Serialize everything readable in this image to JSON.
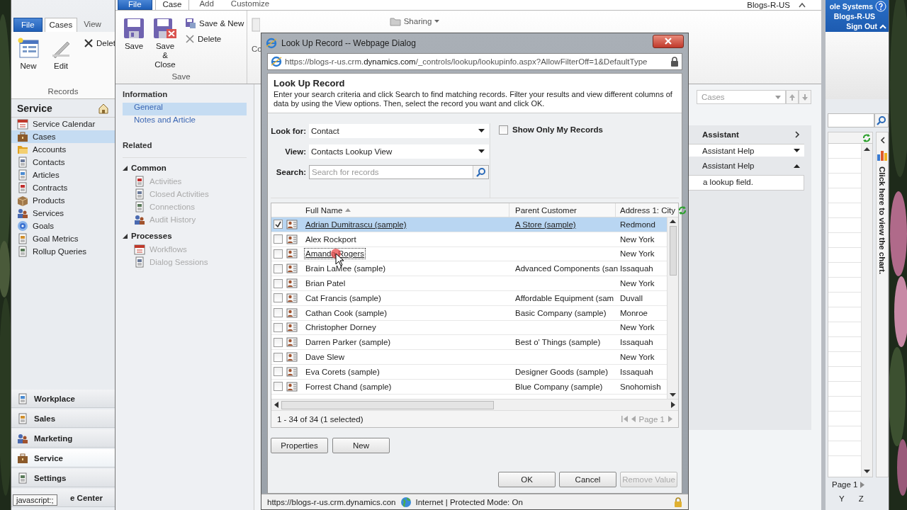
{
  "main_window": {
    "ribbon_tabs": [
      {
        "label": "File",
        "kind": "file",
        "selected": false
      },
      {
        "label": "Cases",
        "kind": "tab",
        "selected": true
      },
      {
        "label": "View",
        "kind": "tab",
        "selected": false
      }
    ],
    "ribbon_buttons": [
      {
        "label": "New",
        "kind": "large"
      },
      {
        "label": "Edit",
        "kind": "large"
      },
      {
        "label": "Delet",
        "kind": "small"
      }
    ],
    "group_label": "Records",
    "nav_title": "Service",
    "nav_items": [
      {
        "label": "Service Calendar",
        "selected": false
      },
      {
        "label": "Cases",
        "selected": true
      },
      {
        "label": "Accounts",
        "selected": false
      },
      {
        "label": "Contacts",
        "selected": false
      },
      {
        "label": "Articles",
        "selected": false
      },
      {
        "label": "Contracts",
        "selected": false
      },
      {
        "label": "Products",
        "selected": false
      },
      {
        "label": "Services",
        "selected": false
      },
      {
        "label": "Goals",
        "selected": false
      },
      {
        "label": "Goal Metrics",
        "selected": false
      },
      {
        "label": "Rollup Queries",
        "selected": false
      }
    ],
    "workspaces": [
      {
        "label": "Workplace",
        "kind": "full",
        "selected": false
      },
      {
        "label": "Sales",
        "kind": "full",
        "selected": false
      },
      {
        "label": "Marketing",
        "kind": "full",
        "selected": false
      },
      {
        "label": "Service",
        "kind": "full",
        "selected": true
      },
      {
        "label": "Settings",
        "kind": "full",
        "selected": false
      },
      {
        "label": "e Center",
        "kind": "covered",
        "selected": false
      }
    ],
    "tooltip": "javascript:;",
    "header": {
      "organization": "ole Systems",
      "user": "Blogs-R-US",
      "sign_out": "Sign Out"
    },
    "chart_pane": {
      "label": "Click here to view the chart."
    },
    "pager": "Page 1",
    "index_letters": [
      "Y",
      "Z"
    ]
  },
  "case_window": {
    "top_bar": {
      "user": "Blogs-R-US"
    },
    "ribbon_tabs": [
      {
        "label": "File",
        "kind": "file",
        "selected": false
      },
      {
        "label": "Case",
        "kind": "tab",
        "selected": true
      },
      {
        "label": "Add",
        "kind": "tab",
        "selected": false
      },
      {
        "label": "Customize",
        "kind": "tab",
        "selected": false
      }
    ],
    "ribbon_buttons": [
      {
        "label": "Save",
        "kind": "large"
      },
      {
        "label": "Save & Close",
        "kind": "large"
      },
      {
        "label": "Save & New",
        "kind": "small"
      },
      {
        "label": "Delete",
        "kind": "small"
      }
    ],
    "group_label": "Save",
    "covered_button": "Co",
    "sharing_button": "Sharing",
    "information": {
      "title": "Information",
      "items": [
        {
          "label": "General",
          "selected": true,
          "disabled": false
        },
        {
          "label": "Notes and Article",
          "selected": false,
          "disabled": false
        }
      ]
    },
    "related": {
      "title": "Related",
      "groups": [
        {
          "title": "Common",
          "expanded": true,
          "items": [
            {
              "label": "Activities",
              "selected": false,
              "disabled": true
            },
            {
              "label": "Closed Activities",
              "selected": false,
              "disabled": true
            },
            {
              "label": "Connections",
              "selected": false,
              "disabled": true
            },
            {
              "label": "Audit History",
              "selected": false,
              "disabled": true
            }
          ]
        },
        {
          "title": "Processes",
          "expanded": true,
          "items": [
            {
              "label": "Workflows",
              "selected": false,
              "disabled": true
            },
            {
              "label": "Dialog Sessions",
              "selected": false,
              "disabled": true
            }
          ]
        }
      ]
    },
    "right_panel": {
      "view_select": "Cases",
      "assistant_title": "Assistant",
      "help_select": "Assistant Help",
      "help_title": "Assistant Help",
      "help_text": "a lookup field."
    }
  },
  "dialog": {
    "title": "Look Up Record -- Webpage Dialog",
    "address": "https://blogs-r-us.crm.**dynamics.com**/_controls/lookup/lookupinfo.aspx?AllowFilterOff=1&DefaultType",
    "heading": "Look Up Record",
    "description": "Enter your search criteria and click Search to find matching records. Filter your results and view different columns of data by using the View options. Then, select the record you want and click OK.",
    "fields": [
      {
        "label": "Look for:",
        "kind": "select",
        "value": "Contact"
      },
      {
        "label": "View:",
        "kind": "select",
        "value": "Contacts Lookup View"
      },
      {
        "label": "Search:",
        "kind": "search",
        "placeholder": "Search for records"
      }
    ],
    "only_my_records": {
      "label": "Show Only My Records",
      "checked": false
    },
    "grid": {
      "columns": [
        {
          "label": "Full Name",
          "sorted": true
        },
        {
          "label": "Parent Customer",
          "sorted": false
        },
        {
          "label": "Address 1: City",
          "sorted": false
        }
      ],
      "rows": [
        {
          "name": "Adrian Dumitrascu (sample)",
          "parent": "A Store (sample)",
          "city": "Redmond",
          "checked": true,
          "selected": true,
          "hovered": false
        },
        {
          "name": "Alex Rockport",
          "city": "New York",
          "checked": false,
          "selected": false,
          "hovered": false
        },
        {
          "name": "Amanda Rogers",
          "city": "New York",
          "checked": false,
          "selected": false,
          "hovered": true
        },
        {
          "name": "Brain LaMee (sample)",
          "parent": "Advanced Components (san",
          "city": "Issaquah",
          "checked": false,
          "selected": false,
          "hovered": false
        },
        {
          "name": "Brian Patel",
          "city": "New York",
          "checked": false,
          "selected": false,
          "hovered": false
        },
        {
          "name": "Cat Francis (sample)",
          "parent": "Affordable Equipment (sam",
          "city": "Duvall",
          "checked": false,
          "selected": false,
          "hovered": false
        },
        {
          "name": "Cathan Cook (sample)",
          "parent": "Basic Company (sample)",
          "city": "Monroe",
          "checked": false,
          "selected": false,
          "hovered": false
        },
        {
          "name": "Christopher Dorney",
          "city": "New York",
          "checked": false,
          "selected": false,
          "hovered": false
        },
        {
          "name": "Darren Parker (sample)",
          "parent": "Best o' Things (sample)",
          "city": "Issaquah",
          "checked": false,
          "selected": false,
          "hovered": false
        },
        {
          "name": "Dave Slew",
          "city": "New York",
          "checked": false,
          "selected": false,
          "hovered": false
        },
        {
          "name": "Eva Corets (sample)",
          "parent": "Designer Goods (sample)",
          "city": "Issaquah",
          "checked": false,
          "selected": false,
          "hovered": false
        },
        {
          "name": "Forrest Chand (sample)",
          "parent": "Blue Company (sample)",
          "city": "Snohomish",
          "checked": false,
          "selected": false,
          "hovered": false
        }
      ],
      "record_count": "1 - 34 of 34 (1 selected)",
      "page": "Page 1"
    },
    "buttons": [
      {
        "label": "Properties"
      },
      {
        "label": "New"
      }
    ],
    "actions": [
      {
        "label": "OK",
        "disabled": false
      },
      {
        "label": "Cancel",
        "disabled": false
      },
      {
        "label": "Remove Value",
        "disabled": true
      }
    ],
    "status_bar": {
      "url": "https://blogs-r-us.crm.dynamics.con",
      "zone": "Internet | Protected Mode: On"
    }
  }
}
